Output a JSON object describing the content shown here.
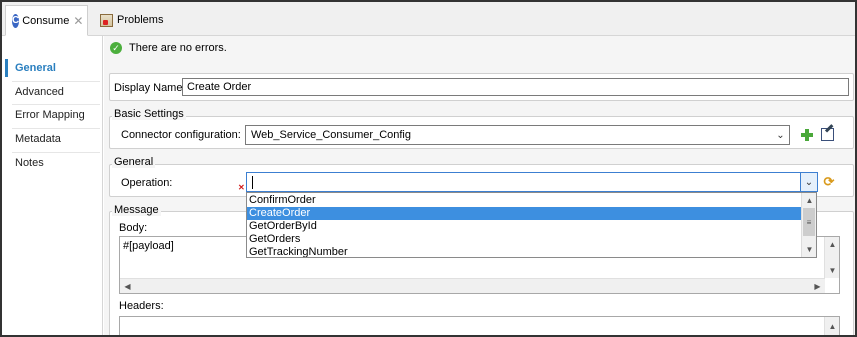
{
  "tabs": {
    "active_label": "Consume",
    "active_close": "✕",
    "problems_label": "Problems"
  },
  "nav": {
    "items": [
      {
        "label": "General"
      },
      {
        "label": "Advanced"
      },
      {
        "label": "Error Mapping"
      },
      {
        "label": "Metadata"
      },
      {
        "label": "Notes"
      }
    ]
  },
  "status": {
    "message": "There are no errors."
  },
  "form": {
    "display_name_label": "Display Name:",
    "display_name_value": "Create Order",
    "basic_settings_title": "Basic Settings",
    "connector_label": "Connector configuration:",
    "connector_value": "Web_Service_Consumer_Config",
    "general_title": "General",
    "operation_label": "Operation:",
    "operation_value": "",
    "message_title": "Message",
    "body_label": "Body:",
    "body_value": "#[payload]",
    "headers_label": "Headers:"
  },
  "dropdown": {
    "options": [
      "ConfirmOrder",
      "CreateOrder",
      "GetOrderById",
      "GetOrders",
      "GetTrackingNumber"
    ],
    "selected": "CreateOrder"
  },
  "colors": {
    "accent": "#2a7fbf",
    "selection": "#3d8fe0",
    "ok": "#4caf3d",
    "error": "#d01c1c"
  },
  "icons": {
    "consume": "consume-icon",
    "problems": "problems-icon",
    "status": "check-circle-icon",
    "add": "plus-icon",
    "edit": "edit-icon",
    "refresh": "refresh-icon",
    "error": "error-icon"
  }
}
